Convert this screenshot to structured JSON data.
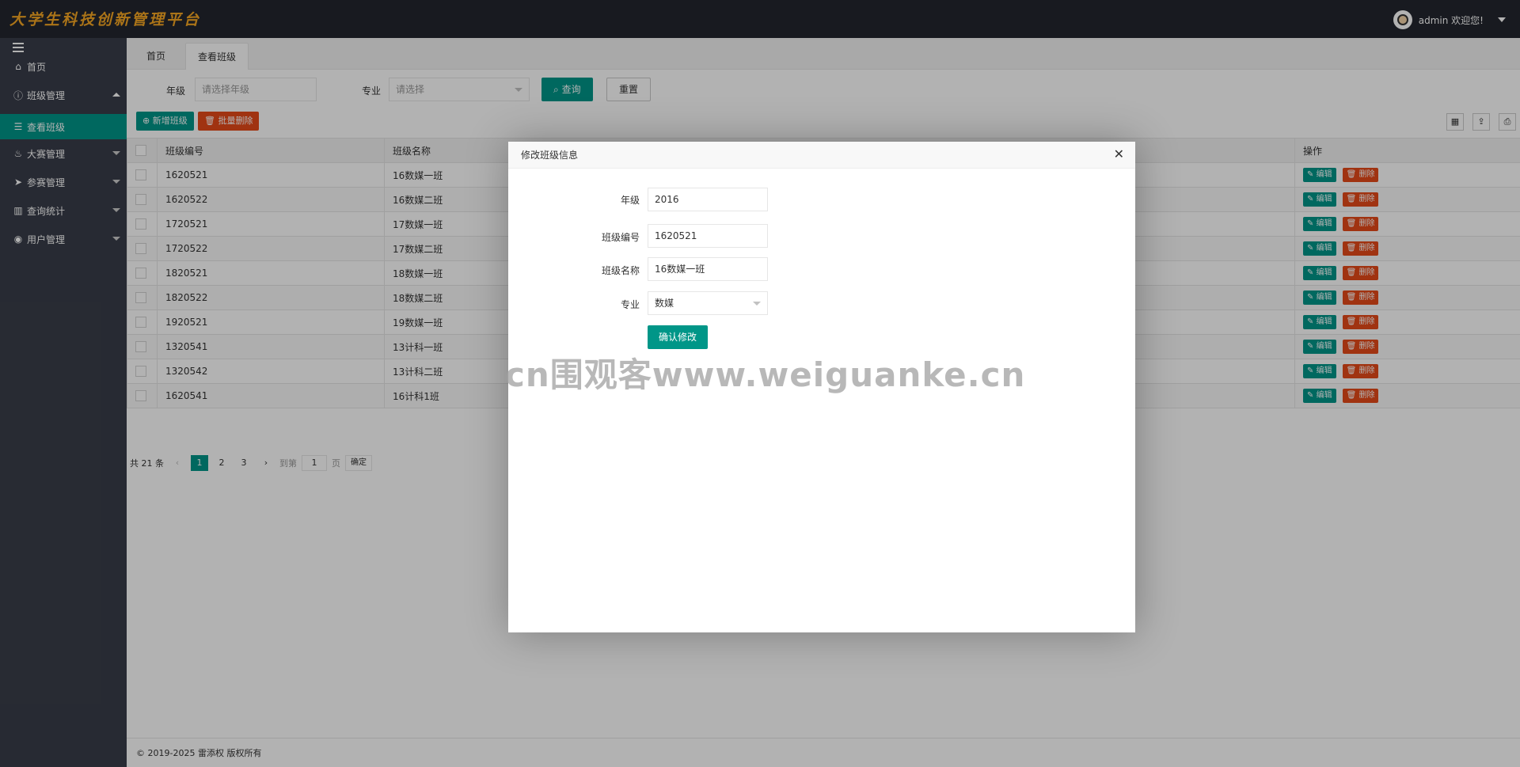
{
  "header": {
    "logo": "大学生科技创新管理平台",
    "user_greeting": "admin 欢迎您!"
  },
  "sidebar": {
    "items": [
      {
        "label": "首页",
        "icon": "home-icon",
        "glyph": "⌂"
      },
      {
        "label": "班级管理",
        "icon": "info-icon",
        "glyph": "ⓘ"
      },
      {
        "label": "查看班级",
        "icon": "list-icon",
        "glyph": "☰"
      },
      {
        "label": "大赛管理",
        "icon": "fire-icon",
        "glyph": "♨"
      },
      {
        "label": "参赛管理",
        "icon": "paper-plane-icon",
        "glyph": "➤"
      },
      {
        "label": "查询统计",
        "icon": "bar-chart-icon",
        "glyph": "▥"
      },
      {
        "label": "用户管理",
        "icon": "user-icon",
        "glyph": "◉"
      }
    ]
  },
  "tabs": [
    "首页",
    "查看班级"
  ],
  "search": {
    "grade_label": "年级",
    "grade_placeholder": "请选择年级",
    "major_label": "专业",
    "major_placeholder": "请选择",
    "query_label": "查询",
    "reset_label": "重置"
  },
  "toolbar": {
    "add_label": "新增班级",
    "batch_delete_label": "批量删除"
  },
  "table": {
    "headers": [
      "班级编号",
      "班级名称",
      "操作"
    ],
    "edit_label": "编辑",
    "delete_label": "删除",
    "rows": [
      [
        "1620521",
        "16数媒一班"
      ],
      [
        "1620522",
        "16数媒二班"
      ],
      [
        "1720521",
        "17数媒一班"
      ],
      [
        "1720522",
        "17数媒二班"
      ],
      [
        "1820521",
        "18数媒一班"
      ],
      [
        "1820522",
        "18数媒二班"
      ],
      [
        "1920521",
        "19数媒一班"
      ],
      [
        "1320541",
        "13计科一班"
      ],
      [
        "1320542",
        "13计科二班"
      ],
      [
        "1620541",
        "16计科1班"
      ]
    ]
  },
  "pager": {
    "total": "共 21 条",
    "pages": [
      "1",
      "2",
      "3"
    ],
    "goto_label": "到第",
    "goto_value": "1",
    "page_unit": "页",
    "confirm": "确定"
  },
  "footer": "© 2019-2025 雷添权 版权所有",
  "modal": {
    "title": "修改班级信息",
    "fields": [
      {
        "label": "年级",
        "value": "2016"
      },
      {
        "label": "班级编号",
        "value": "1620521"
      },
      {
        "label": "班级名称",
        "value": "16数媒一班"
      },
      {
        "label": "专业",
        "value": "数媒"
      }
    ],
    "submit_label": "确认修改"
  },
  "watermark": "cn围观客www.weiguanke.cn",
  "colors": {
    "primary": "#009688",
    "danger": "#e64a19",
    "header_bg": "#23262e",
    "sidebar_bg": "#393d49",
    "logo": "#f5a623"
  }
}
